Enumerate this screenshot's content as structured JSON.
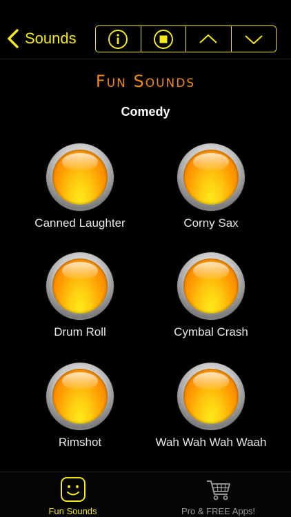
{
  "navbar": {
    "back_label": "Sounds",
    "controls": [
      {
        "icon": "info-icon"
      },
      {
        "icon": "stop-icon"
      },
      {
        "icon": "chevron-up-icon"
      },
      {
        "icon": "chevron-down-icon"
      }
    ]
  },
  "header": {
    "logo_text": "Fun Sounds",
    "category": "Comedy"
  },
  "sounds": [
    {
      "label": "Canned Laughter"
    },
    {
      "label": "Corny Sax"
    },
    {
      "label": "Drum Roll"
    },
    {
      "label": "Cymbal Crash"
    },
    {
      "label": "Rimshot"
    },
    {
      "label": "Wah Wah Wah Waah"
    }
  ],
  "tabbar": {
    "tabs": [
      {
        "label": "Fun Sounds",
        "icon": "smiley-icon",
        "active": true
      },
      {
        "label": "Pro & FREE Apps!",
        "icon": "shopping-cart-icon",
        "active": false
      }
    ]
  },
  "colors": {
    "accent": "#f2e81a",
    "logo": "#ee8a1c",
    "background": "#000000"
  }
}
